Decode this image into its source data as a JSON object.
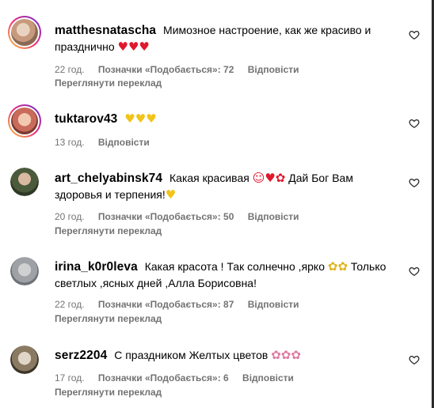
{
  "comments": [
    {
      "username": "matthesnatascha",
      "text": "Мимозное настроение, как же красиво и празднично",
      "emojis": "♥♥♥",
      "time": "22 год.",
      "likes": "Позначки «Подобається»: 72",
      "reply": "Відповісти",
      "translate": "Переглянути переклад"
    },
    {
      "username": "tuktarov43",
      "text": "",
      "emojis": "♥♥♥",
      "time": "13 год.",
      "reply": "Відповісти"
    },
    {
      "username": "art_chelyabinsk74",
      "text_a": "Какая красивая",
      "emojis_a": "☺♥✿",
      "text_b": "Дай Бог Вам здоровья и терпения!",
      "emojis_b": "♥",
      "time": "20 год.",
      "likes": "Позначки «Подобається»: 50",
      "reply": "Відповісти",
      "translate": "Переглянути переклад"
    },
    {
      "username": "irina_k0r0leva",
      "text_a": "Какая красота ! Так солнечно ,ярко",
      "emojis_a": "✿✿",
      "text_b": "Только светлых ,ясных дней ,Алла Борисовна!",
      "time": "22 год.",
      "likes": "Позначки «Подобається»: 87",
      "reply": "Відповісти",
      "translate": "Переглянути переклад"
    },
    {
      "username": "serz2204",
      "text": "С праздником Желтых цветов",
      "emojis": "✿✿✿",
      "time": "17 год.",
      "likes": "Позначки «Подобається»: 6",
      "reply": "Відповісти",
      "translate": "Переглянути переклад"
    }
  ]
}
